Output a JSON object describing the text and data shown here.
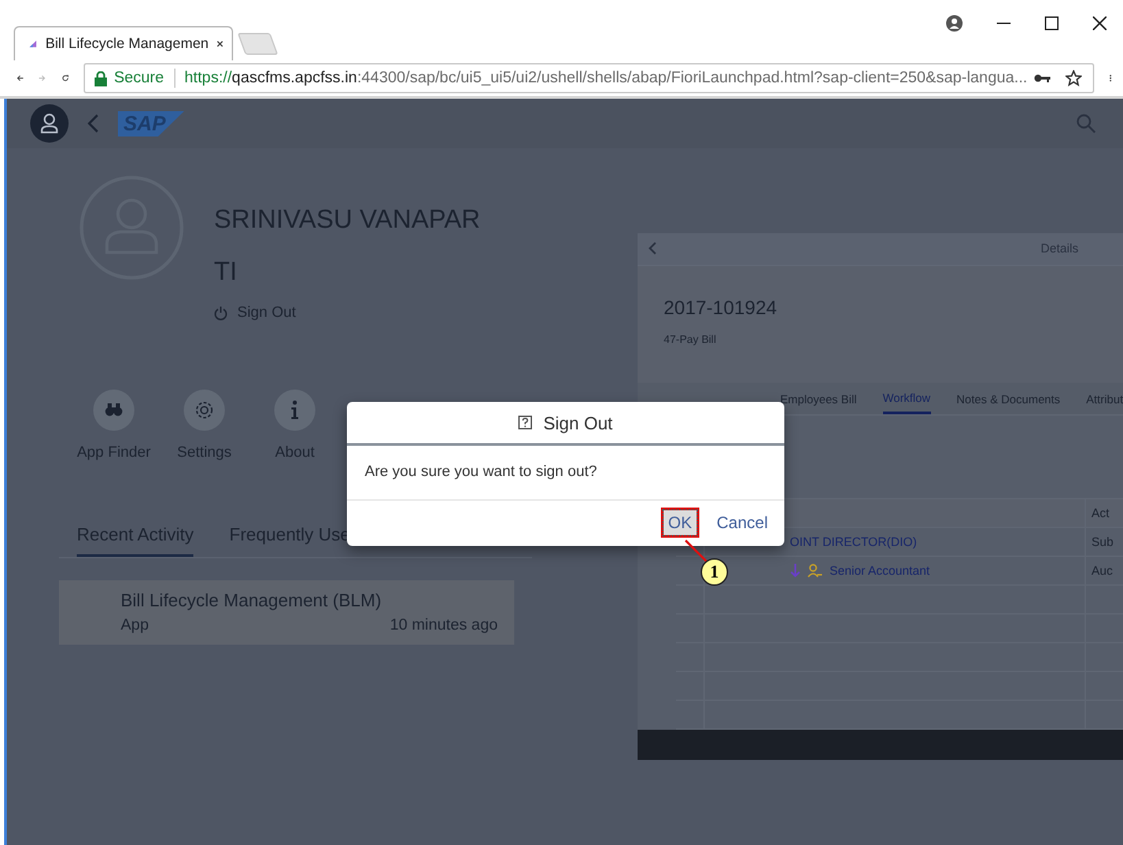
{
  "browser": {
    "tabs": [
      {
        "title": "Bill Lifecycle Managemen",
        "selected": true
      }
    ],
    "forward_disabled": true,
    "secure_label": "Secure",
    "url_scheme": "https://",
    "url_host": "qascfms.apcfss.in",
    "url_path": ":44300/sap/bc/ui5_ui5/ui2/ushell/shells/abap/FioriLaunchpad.html?sap-client=250&sap-langua..."
  },
  "shell": {
    "logo": "SAP"
  },
  "profile": {
    "name_lines": [
      "SRINIVASU VANAPAR",
      "TI"
    ],
    "sign_out": "Sign Out"
  },
  "actions": [
    {
      "label": "App Finder",
      "kind": "binoculars"
    },
    {
      "label": "Settings",
      "kind": "gear"
    },
    {
      "label": "About",
      "kind": "info"
    }
  ],
  "tabs": [
    {
      "label": "Recent Activity",
      "selected": true
    },
    {
      "label": "Frequently Use",
      "selected": false
    }
  ],
  "recent": [
    {
      "title": "Bill Lifecycle Management (BLM)",
      "type": "App",
      "time": "10 minutes ago"
    }
  ],
  "details": {
    "header_title": "Details",
    "title": "2017-101924",
    "subtitle": "47-Pay Bill",
    "tabs": [
      {
        "label": "Employees Bill",
        "selected": false
      },
      {
        "label": "Workflow",
        "selected": true
      },
      {
        "label": "Notes & Documents",
        "selected": false
      },
      {
        "label": "Attribut",
        "selected": false
      }
    ],
    "column_2": "Act",
    "rows": [
      {
        "name": "OINT DIRECTOR(DIO)",
        "column_2": "Sub",
        "kind": "plain"
      },
      {
        "name": "Senior Accountant",
        "column_2": "Auc",
        "kind": "forwarded"
      }
    ]
  },
  "dialog": {
    "title": "Sign Out",
    "message": "Are you sure you want to sign out?",
    "buttons": [
      {
        "label": "OK",
        "highlighted": true
      },
      {
        "label": "Cancel",
        "highlighted": false
      }
    ]
  },
  "callout": {
    "number": "1"
  }
}
